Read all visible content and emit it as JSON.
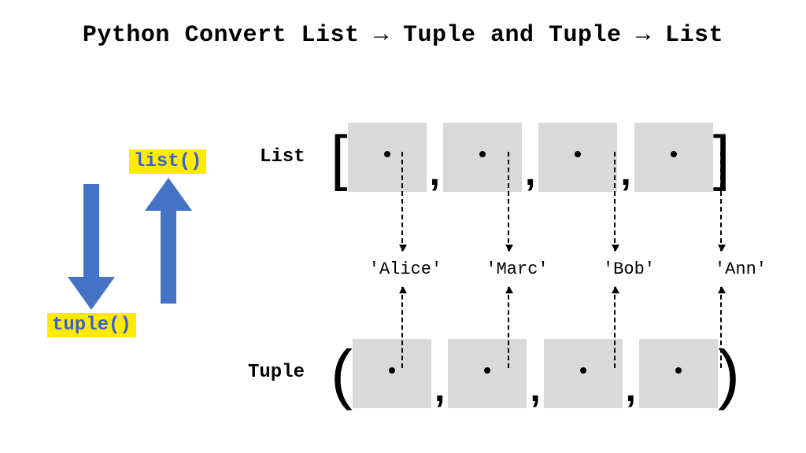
{
  "title": "Python Convert List → Tuple and Tuple → List",
  "left": {
    "list_fn": "list()",
    "tuple_fn": "tuple()"
  },
  "labels": {
    "list": "List",
    "tuple": "Tuple"
  },
  "brackets": {
    "list_open": "[",
    "list_close": "]",
    "tuple_open": "(",
    "tuple_close": ")",
    "sep": ","
  },
  "values": [
    "'Alice'",
    "'Marc'",
    "'Bob'",
    "'Ann'"
  ],
  "colors": {
    "highlight_bg": "#ffeb00",
    "highlight_fg": "#3b5fce",
    "arrow": "#4472c4",
    "cell": "#d9d9d9"
  }
}
